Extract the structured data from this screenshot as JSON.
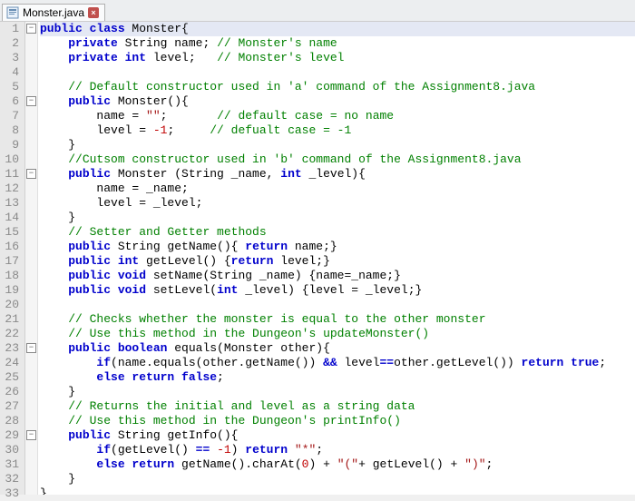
{
  "tab": {
    "filename": "Monster.java",
    "close_glyph": "×"
  },
  "gutter_lines": 33,
  "fold_marks": {
    "1": "−",
    "6": "−",
    "11": "−",
    "23": "−",
    "29": "−"
  },
  "highlighted_line": 1,
  "code": {
    "1": [
      [
        "kw",
        "public class "
      ],
      [
        "id",
        "Monster"
      ],
      [
        "id",
        "{"
      ]
    ],
    "2": [
      [
        "id",
        "    "
      ],
      [
        "kw",
        "private "
      ],
      [
        "id",
        "String name; "
      ],
      [
        "cm",
        "// Monster's name"
      ]
    ],
    "3": [
      [
        "id",
        "    "
      ],
      [
        "kw",
        "private int "
      ],
      [
        "id",
        "level;   "
      ],
      [
        "cm",
        "// Monster's level"
      ]
    ],
    "4": [
      [
        "id",
        ""
      ]
    ],
    "5": [
      [
        "id",
        "    "
      ],
      [
        "cm",
        "// Default constructor used in 'a' command of the Assignment8.java"
      ]
    ],
    "6": [
      [
        "id",
        "    "
      ],
      [
        "kw",
        "public "
      ],
      [
        "id",
        "Monster(){"
      ]
    ],
    "7": [
      [
        "id",
        "        name = "
      ],
      [
        "str",
        "\"\""
      ],
      [
        "id",
        ";       "
      ],
      [
        "cm",
        "// default case = no name"
      ]
    ],
    "8": [
      [
        "id",
        "        level = "
      ],
      [
        "num",
        "-1"
      ],
      [
        "id",
        ";     "
      ],
      [
        "cm",
        "// defualt case = -1"
      ]
    ],
    "9": [
      [
        "id",
        "    }"
      ]
    ],
    "10": [
      [
        "id",
        "    "
      ],
      [
        "cm",
        "//Cutsom constructor used in 'b' command of the Assignment8.java"
      ]
    ],
    "11": [
      [
        "id",
        "    "
      ],
      [
        "kw",
        "public "
      ],
      [
        "id",
        "Monster (String _name, "
      ],
      [
        "kw",
        "int "
      ],
      [
        "id",
        "_level){"
      ]
    ],
    "12": [
      [
        "id",
        "        name = _name;"
      ]
    ],
    "13": [
      [
        "id",
        "        level = _level;"
      ]
    ],
    "14": [
      [
        "id",
        "    }"
      ]
    ],
    "15": [
      [
        "id",
        "    "
      ],
      [
        "cm",
        "// Setter and Getter methods"
      ]
    ],
    "16": [
      [
        "id",
        "    "
      ],
      [
        "kw",
        "public "
      ],
      [
        "id",
        "String getName(){ "
      ],
      [
        "kw",
        "return "
      ],
      [
        "id",
        "name;}"
      ]
    ],
    "17": [
      [
        "id",
        "    "
      ],
      [
        "kw",
        "public int "
      ],
      [
        "id",
        "getLevel() {"
      ],
      [
        "kw",
        "return "
      ],
      [
        "id",
        "level;}"
      ]
    ],
    "18": [
      [
        "id",
        "    "
      ],
      [
        "kw",
        "public void "
      ],
      [
        "id",
        "setName(String _name) {name=_name;}"
      ]
    ],
    "19": [
      [
        "id",
        "    "
      ],
      [
        "kw",
        "public void "
      ],
      [
        "id",
        "setLevel("
      ],
      [
        "kw",
        "int "
      ],
      [
        "id",
        "_level) {level = _level;}"
      ]
    ],
    "20": [
      [
        "id",
        ""
      ]
    ],
    "21": [
      [
        "id",
        "    "
      ],
      [
        "cm",
        "// Checks whether the monster is equal to the other monster"
      ]
    ],
    "22": [
      [
        "id",
        "    "
      ],
      [
        "cm",
        "// Use this method in the Dungeon's updateMonster()"
      ]
    ],
    "23": [
      [
        "id",
        "    "
      ],
      [
        "kw",
        "public boolean "
      ],
      [
        "id",
        "equals(Monster other){"
      ]
    ],
    "24": [
      [
        "id",
        "        "
      ],
      [
        "kw",
        "if"
      ],
      [
        "id",
        "(name.equals(other.getName()) "
      ],
      [
        "kw",
        "&& "
      ],
      [
        "id",
        "level"
      ],
      [
        "kw",
        "=="
      ],
      [
        "id",
        "other.getLevel()) "
      ],
      [
        "kw",
        "return true"
      ],
      [
        "id",
        ";"
      ]
    ],
    "25": [
      [
        "id",
        "        "
      ],
      [
        "kw",
        "else return false"
      ],
      [
        "id",
        ";"
      ]
    ],
    "26": [
      [
        "id",
        "    }"
      ]
    ],
    "27": [
      [
        "id",
        "    "
      ],
      [
        "cm",
        "// Returns the initial and level as a string data"
      ]
    ],
    "28": [
      [
        "id",
        "    "
      ],
      [
        "cm",
        "// Use this method in the Dungeon's printInfo()"
      ]
    ],
    "29": [
      [
        "id",
        "    "
      ],
      [
        "kw",
        "public "
      ],
      [
        "id",
        "String getInfo(){"
      ]
    ],
    "30": [
      [
        "id",
        "        "
      ],
      [
        "kw",
        "if"
      ],
      [
        "id",
        "(getLevel() "
      ],
      [
        "kw",
        "== "
      ],
      [
        "num",
        "-1"
      ],
      [
        "id",
        ") "
      ],
      [
        "kw",
        "return "
      ],
      [
        "str",
        "\"*\""
      ],
      [
        "id",
        ";"
      ]
    ],
    "31": [
      [
        "id",
        "        "
      ],
      [
        "kw",
        "else return "
      ],
      [
        "id",
        "getName().charAt("
      ],
      [
        "num",
        "0"
      ],
      [
        "id",
        ") + "
      ],
      [
        "str",
        "\"(\""
      ],
      [
        "id",
        "+ getLevel() + "
      ],
      [
        "str",
        "\")\""
      ],
      [
        "id",
        ";"
      ]
    ],
    "32": [
      [
        "id",
        "    }"
      ]
    ],
    "33": [
      [
        "id",
        "}"
      ]
    ]
  }
}
